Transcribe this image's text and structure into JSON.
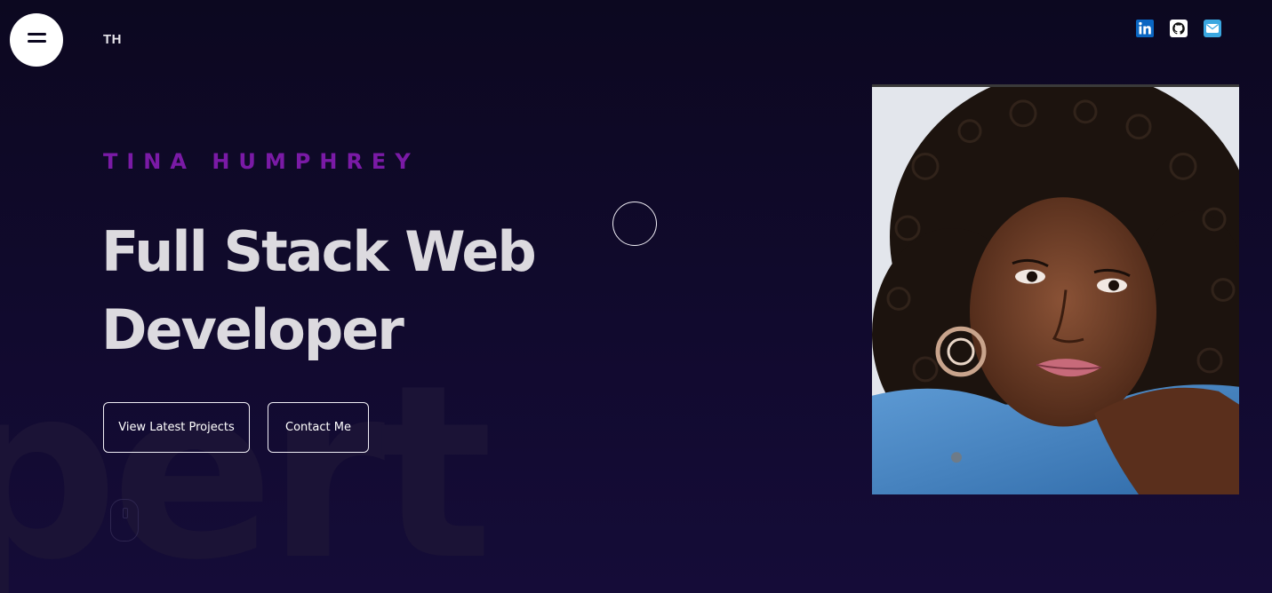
{
  "header": {
    "logo_text": "TH",
    "menu_icon": "hamburger-icon",
    "social": [
      {
        "name": "linkedin-icon",
        "color": "#0a66c2"
      },
      {
        "name": "github-icon",
        "color": "#ffffff"
      },
      {
        "name": "email-icon",
        "color": "#3ba7e0"
      }
    ]
  },
  "hero": {
    "eyebrow": "TINA HUMPHREY",
    "headline": "Full Stack Web Developer",
    "background_word": "pert",
    "buttons": {
      "projects_label": "View Latest Projects",
      "contact_label": "Contact Me"
    }
  },
  "portrait": {
    "subject": "portrait-photo"
  },
  "colors": {
    "background": "#0c0820",
    "accent": "#7a1aa6",
    "headline": "#dcdadf"
  }
}
